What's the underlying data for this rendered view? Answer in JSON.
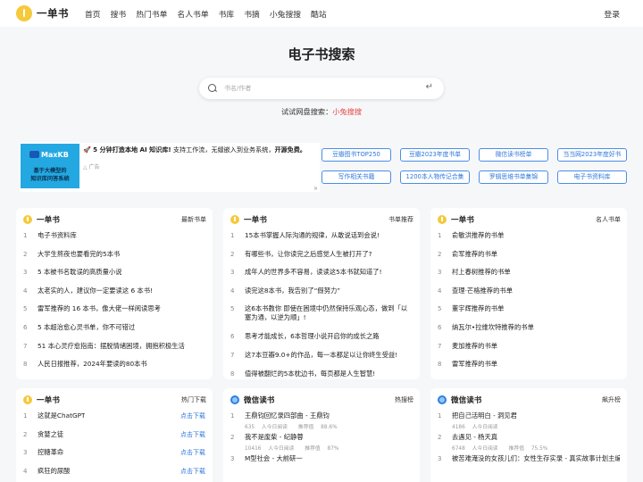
{
  "nav": {
    "brand": "一单书",
    "links": [
      "首页",
      "搜书",
      "热门书单",
      "名人书单",
      "书库",
      "书摘",
      "小兔搜搜",
      "酷站"
    ],
    "login": "登录"
  },
  "hero": {
    "title": "电子书搜索",
    "search_placeholder": "书名/作者",
    "pan_label": "试试网盘搜索：",
    "pan_link": "小兔搜搜"
  },
  "ad": {
    "image_brand": "MaxKB",
    "image_line1": "基于大模型的",
    "image_line2": "知识库问答系统",
    "text_bold": "5 分钟打造本地 AI 知识库!",
    "text_rest": " 支持工作流，无缝嵌入到业务系统，",
    "text_bold2": "开源免费。",
    "tag": "广告",
    "close": "×"
  },
  "tags": [
    "豆瓣图书TOP250",
    "豆瓣2023年度书单",
    "微信读书榜单",
    "当当网2023年度好书",
    "写作相关书籍",
    "1200本人物传记合集",
    "罗辑思维书单集锦",
    "电子书资料库"
  ],
  "colors": {
    "accent": "#2f78de",
    "brand_yellow": "#f6c93a",
    "red_link": "#e54545"
  },
  "card_latest": {
    "title": "一单书",
    "tag": "最新书单",
    "items": [
      "电子书资料库",
      "大学生熬夜也要看完的5本书",
      "5 本被书名耽误的高质量小说",
      "太老实的人，建议你一定要读这 6 本书!",
      "雷军推荐的 16 本书，像大佬一样阅读思考",
      "5 本超治愈心灵书单，你不可错过",
      "51 本心灵疗愈指南：摆脱情绪困境，拥抱积极生活",
      "人民日报推荐，2024年要读的80本书"
    ]
  },
  "card_recommend": {
    "title": "一单书",
    "tag": "书单推荐",
    "items": [
      "15本书掌握人际沟通的规律，从敢说话到会说!",
      "有哪些书，让你读完之后感觉人生被打开了?",
      "成年人的世界多不容易，读读这5本书就知道了!",
      "读完这8本书，我告别了“假努力”",
      "这6本书教你 即使在困境中仍然保持乐观心态，做到「以塞为通，以逆为顺」!",
      "思考才能成长，6本哲理小说开启你的成长之路",
      "这7本豆瓣9.0+的作品，每一本都足以让你终生受益!",
      "值得被翻烂的5本枕边书，每页都是人生智慧!"
    ]
  },
  "card_famous": {
    "title": "一单书",
    "tag": "名人书单",
    "items": [
      "俞敏洪推荐的书单",
      "俞军推荐的书单",
      "村上春树推荐的书单",
      "查理·芒格推荐的书单",
      "董宇辉推荐的书单",
      "纳瓦尔•拉维坎特推荐的书单",
      "麦加推荐的书单",
      "雷军推荐的书单"
    ]
  },
  "card_download": {
    "title": "一单书",
    "tag": "热门下载",
    "action": "点击下载",
    "items": [
      "这就是ChatGPT",
      "贪婪之徒",
      "控糖革命",
      "疯狂的尿酸"
    ]
  },
  "card_wx_hot": {
    "title": "微信读书",
    "tag": "热搜榜",
    "read_label": "人今日阅读",
    "rate_label": "推荐值",
    "items": [
      {
        "title": "王鼎钧回忆录四部曲 - 王鼎钧",
        "readers": "635",
        "rate": "88.6%"
      },
      {
        "title": "我不是废柴 - 纪静蓉",
        "readers": "10416",
        "rate": "87%"
      },
      {
        "title": "M型社会 - 大前研一",
        "readers": "",
        "rate": ""
      }
    ]
  },
  "card_wx_rise": {
    "title": "微信读书",
    "tag": "飙升榜",
    "read_label": "人今日阅读",
    "rate_label": "推荐值",
    "items": [
      {
        "title": "把自己活明白 - 洞见君",
        "readers": "4186",
        "rate": ""
      },
      {
        "title": "去遇见 - 杨天真",
        "readers": "6748",
        "rate": "75.5%"
      },
      {
        "title": "被苦难淹没的女孩儿们：女性生存实录 - 真实故事计划主编",
        "readers": "",
        "rate": ""
      }
    ]
  }
}
